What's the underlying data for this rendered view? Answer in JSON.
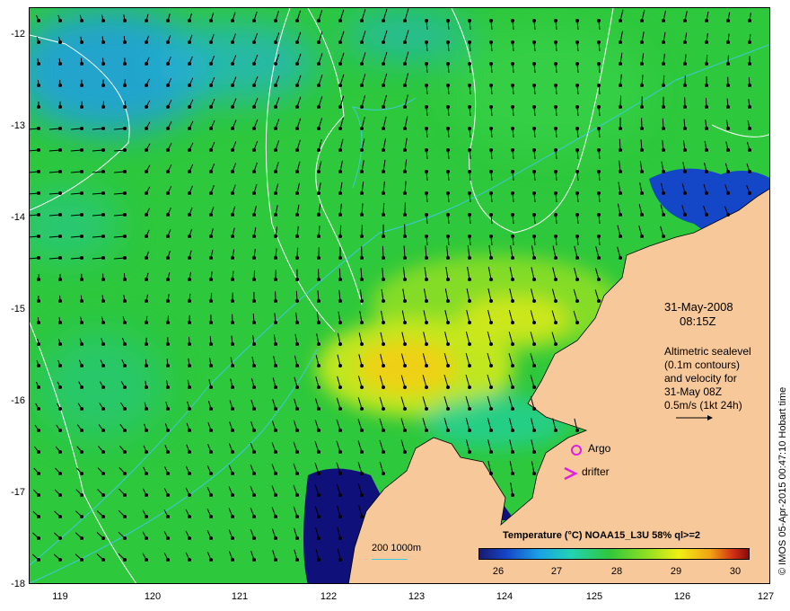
{
  "map": {
    "y_ticks": [
      "-12",
      "-13",
      "-14",
      "-15",
      "-16",
      "-17",
      "-18"
    ],
    "x_ticks": [
      "119",
      "120",
      "121",
      "122",
      "123",
      "124",
      "125",
      "126",
      "127"
    ],
    "lon_range": [
      118.6,
      127
    ],
    "lat_range": [
      -18,
      -11.8
    ]
  },
  "annotations": {
    "date": "31-May-2008",
    "time": "08:15Z",
    "legend_lines": [
      "Altimetric sealevel",
      "(0.1m contours)",
      "and velocity for",
      "31-May 08Z",
      "0.5m/s (1kt 24h)"
    ],
    "argo_label": "Argo",
    "drifter_label": "drifter",
    "scale_label": "200  1000m"
  },
  "colorbar": {
    "title": "Temperature (°C) NOAA15_L3U 58% ql>=2",
    "ticks": [
      "26",
      "27",
      "28",
      "29",
      "30"
    ]
  },
  "credit": "© IMOS 05-Apr-2015 00:47:10 Hobart time",
  "colors": {
    "land": "#f7c89a",
    "sea_base": "#2ec83c",
    "cool_water": "#1e9ee6",
    "warm_water": "#e8f014",
    "coastal_cold": "#10107a",
    "marker": "#e020e0",
    "contour": "#ffffff",
    "isobath": "#40c8e0"
  },
  "icons": [
    "argo-circle-icon",
    "drifter-chevron-icon",
    "velocity-arrow-icon"
  ]
}
